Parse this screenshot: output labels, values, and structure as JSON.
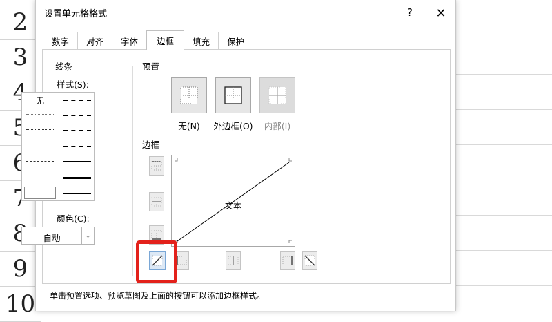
{
  "sheet": {
    "row_numbers": [
      "2",
      "3",
      "4",
      "5",
      "6",
      "7",
      "8",
      "9",
      "10"
    ]
  },
  "dialog": {
    "title": "设置单元格格式",
    "help_glyph": "?",
    "close_glyph": "✕",
    "tabs": [
      {
        "label": "数字",
        "active": false
      },
      {
        "label": "对齐",
        "active": false
      },
      {
        "label": "字体",
        "active": false
      },
      {
        "label": "边框",
        "active": true
      },
      {
        "label": "填充",
        "active": false
      },
      {
        "label": "保护",
        "active": false
      }
    ],
    "line": {
      "group_label": "线条",
      "style_label": "样式(S):",
      "style_none": "无",
      "color_label": "颜色(C):",
      "color_value": "自动"
    },
    "presets": {
      "group_label": "预置",
      "none_label": "无(N)",
      "outline_label": "外边框(O)",
      "inside_label": "内部(I)"
    },
    "border": {
      "group_label": "边框",
      "preview_text": "文本"
    },
    "hint": "单击预置选项、预览草图及上面的按钮可以添加边框样式。"
  },
  "colors": {
    "highlight": "#e3211b",
    "selection": "#217346"
  }
}
